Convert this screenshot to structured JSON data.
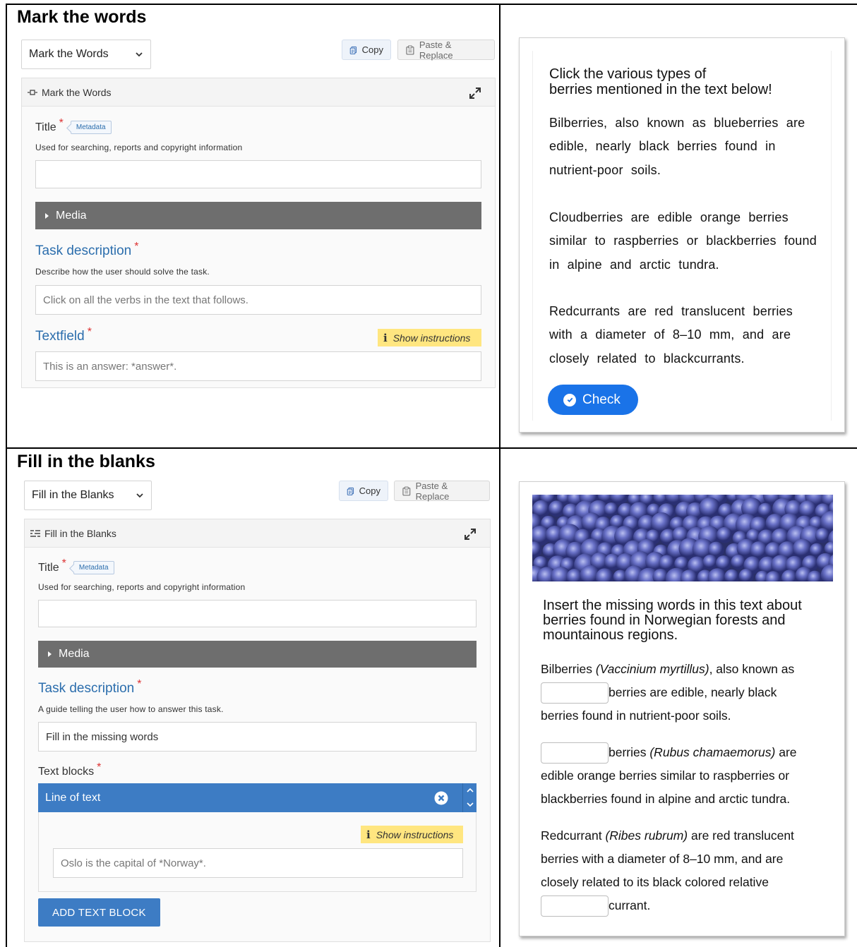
{
  "sections": {
    "mark": {
      "heading": "Mark the words",
      "select_value": "Mark the Words",
      "copy_label": "Copy",
      "paste_label": "Paste & Replace",
      "form_header": "Mark the Words",
      "title_label": "Title",
      "metadata_tag": "Metadata",
      "title_desc": "Used for searching, reports and copyright information",
      "title_value": "",
      "media_label": "Media",
      "task_label": "Task description",
      "task_desc": "Describe how the user should solve the task.",
      "task_placeholder": "Click on all the verbs in the text that follows.",
      "textfield_label": "Textfield",
      "show_instructions": "Show instructions",
      "textfield_placeholder": "This is an answer: *answer*.",
      "preview": {
        "question_line1": "Click the various types of",
        "question_line2": "berries mentioned in the text below!",
        "p1": "Bilberries, also known as blueberries are edible, nearly black berries found in nutrient-poor soils.",
        "p2": "Cloudberries are edible orange berries similar to raspberries or blackberries found in alpine and arctic tundra.",
        "p3": "Redcurrants are red translucent berries with a diameter of 8–10 mm, and are closely related to blackcurrants.",
        "check_label": "Check"
      }
    },
    "fill": {
      "heading": "Fill in the blanks",
      "select_value": "Fill in the Blanks",
      "copy_label": "Copy",
      "paste_label": "Paste & Replace",
      "form_header": "Fill in the Blanks",
      "title_label": "Title",
      "metadata_tag": "Metadata",
      "title_desc": "Used for searching, reports and copyright information",
      "title_value": "",
      "media_label": "Media",
      "task_label": "Task description",
      "task_desc": "A guide telling the user how to answer this task.",
      "task_value": "Fill in the missing words",
      "blocks_label": "Text blocks",
      "line_label": "Line of text",
      "show_instructions": "Show instructions",
      "line_placeholder": "Oslo is the capital of *Norway*.",
      "add_block_label": "ADD TEXT BLOCK",
      "preview": {
        "question_line1": "Insert the missing words in this text about",
        "question_line2": "berries found in Norwegian forests and",
        "question_line3": "mountainous regions.",
        "p1_a": "Bilberries ",
        "p1_latin": "(Vaccinium myrtillus)",
        "p1_b": ", also known as",
        "p1_c": "berries are edible, nearly black",
        "p1_d": "berries found in nutrient-poor soils.",
        "p2_a": "berries ",
        "p2_latin": "(Rubus chamaemorus)",
        "p2_b": " are",
        "p2_c": "edible orange berries similar to raspberries or",
        "p2_d": "blackberries found in alpine and arctic tundra.",
        "p3_a": "Redcurrant ",
        "p3_latin": "(Ribes rubrum)",
        "p3_b": " are red translucent",
        "p3_c": "berries with a diameter of 8–10 mm, and are",
        "p3_d": "closely related to its black colored relative",
        "p3_e": "currant."
      }
    }
  },
  "icons": {
    "copy": "copy-icon",
    "paste": "clipboard-icon",
    "expand": "expand-icon",
    "dropdown": "chevron-down-icon",
    "media": "caret-right-icon",
    "info": "info-icon",
    "remove": "close-circle-icon",
    "check": "check-circle-icon"
  },
  "colors": {
    "accent": "#3d7cc4",
    "label_blue": "#2c6ead",
    "instructions_bg": "#ffe680",
    "check_button": "#1a73e8",
    "media_bar": "#6e6e6e"
  }
}
